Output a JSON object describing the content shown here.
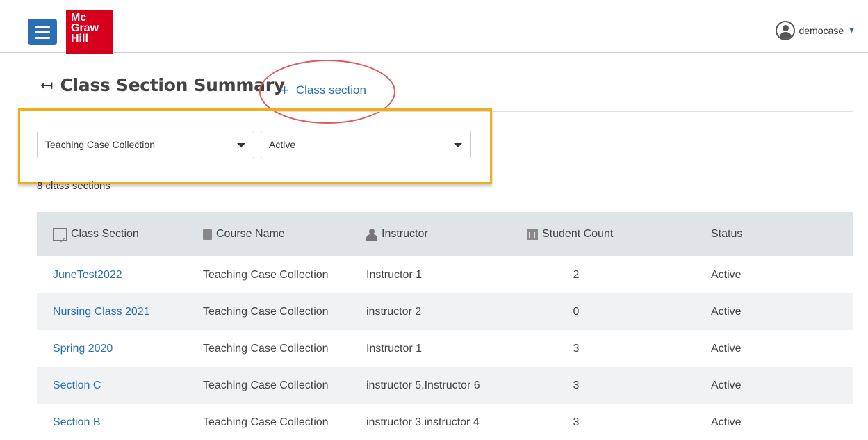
{
  "header": {
    "logo_lines": [
      "Mc",
      "Graw",
      "Hill"
    ],
    "username": "democase"
  },
  "page": {
    "title": "Class Section Summary",
    "add_label": "Class section"
  },
  "filters": {
    "course": "Teaching Case Collection",
    "status": "Active"
  },
  "count_label": "8 class sections",
  "table": {
    "headers": [
      "Class Section",
      "Course Name",
      "Instructor",
      "Student Count",
      "Status"
    ],
    "rows": [
      {
        "section": "JuneTest2022",
        "course": "Teaching Case Collection",
        "instructor": "Instructor 1",
        "count": "2",
        "status": "Active"
      },
      {
        "section": "Nursing Class 2021",
        "course": "Teaching Case Collection",
        "instructor": "instructor 2",
        "count": "0",
        "status": "Active"
      },
      {
        "section": "Spring 2020",
        "course": "Teaching Case Collection",
        "instructor": "Instructor 1",
        "count": "3",
        "status": "Active"
      },
      {
        "section": "Section C",
        "course": "Teaching Case Collection",
        "instructor": "instructor 5,Instructor 6",
        "count": "3",
        "status": "Active"
      },
      {
        "section": "Section B",
        "course": "Teaching Case Collection",
        "instructor": "instructor 3,instructor 4",
        "count": "3",
        "status": "Active"
      }
    ]
  },
  "colors": {
    "brand_red": "#d6001c",
    "accent_blue": "#2a6fb5",
    "highlight_orange": "#f2ad1c",
    "annotation_red": "#e05a5a"
  }
}
